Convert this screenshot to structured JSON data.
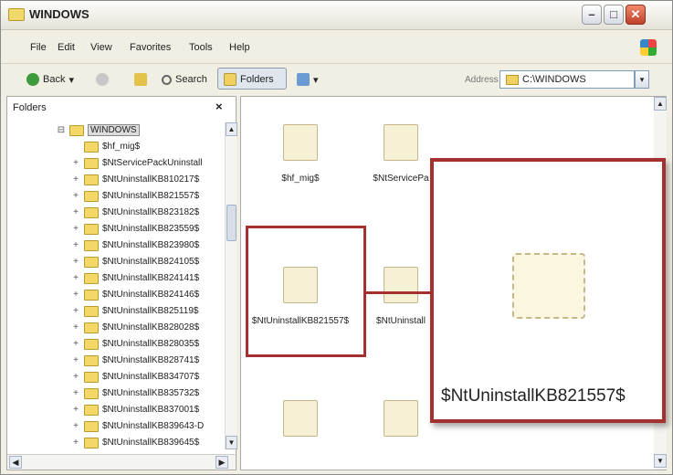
{
  "window": {
    "title": "WINDOWS",
    "controls": {
      "minimize": "–",
      "maximize": "□",
      "close": "✕"
    }
  },
  "menu": [
    "File",
    "Edit",
    "View",
    "Favorites",
    "Tools",
    "Help"
  ],
  "toolbar": {
    "back": "Back",
    "back_arrow": "▾",
    "search": "Search",
    "folders": "Folders",
    "views_arrow": "▾",
    "address_label": "Address",
    "address_value": "C:\\WINDOWS",
    "address_drop": "▾"
  },
  "folders_pane": {
    "title": "Folders",
    "close": "×",
    "root": {
      "expander": "⊟",
      "label": "WINDOWS"
    },
    "items": [
      {
        "expander": "",
        "label": "$hf_mig$"
      },
      {
        "expander": "+",
        "label": "$NtServicePackUninstall"
      },
      {
        "expander": "+",
        "label": "$NtUninstallKB810217$"
      },
      {
        "expander": "+",
        "label": "$NtUninstallKB821557$"
      },
      {
        "expander": "+",
        "label": "$NtUninstallKB823182$"
      },
      {
        "expander": "+",
        "label": "$NtUninstallKB823559$"
      },
      {
        "expander": "+",
        "label": "$NtUninstallKB823980$"
      },
      {
        "expander": "+",
        "label": "$NtUninstallKB824105$"
      },
      {
        "expander": "+",
        "label": "$NtUninstallKB824141$"
      },
      {
        "expander": "+",
        "label": "$NtUninstallKB824146$"
      },
      {
        "expander": "+",
        "label": "$NtUninstallKB825119$"
      },
      {
        "expander": "+",
        "label": "$NtUninstallKB828028$"
      },
      {
        "expander": "+",
        "label": "$NtUninstallKB828035$"
      },
      {
        "expander": "+",
        "label": "$NtUninstallKB828741$"
      },
      {
        "expander": "+",
        "label": "$NtUninstallKB834707$"
      },
      {
        "expander": "+",
        "label": "$NtUninstallKB835732$"
      },
      {
        "expander": "+",
        "label": "$NtUninstallKB837001$"
      },
      {
        "expander": "+",
        "label": "$NtUninstallKB839643-D"
      },
      {
        "expander": "+",
        "label": "$NtUninstallKB839645$"
      }
    ],
    "scroll": {
      "up": "▲",
      "down": "▼",
      "left": "◀",
      "right": "▶"
    }
  },
  "content": {
    "items": [
      {
        "label": "$hf_mig$"
      },
      {
        "label": "$NtServicePa"
      },
      {
        "label": "$NtUninstallKB821557$"
      },
      {
        "label": "$NtUninstall"
      }
    ],
    "scroll": {
      "up": "▲",
      "down": "▼"
    }
  },
  "zoom": {
    "label": "$NtUninstallKB821557$"
  },
  "icons": [
    "folder-icon",
    "back-arrow-icon",
    "forward-arrow-icon",
    "up-folder-icon",
    "search-icon",
    "folders-icon",
    "views-icon",
    "windows-logo-icon"
  ]
}
